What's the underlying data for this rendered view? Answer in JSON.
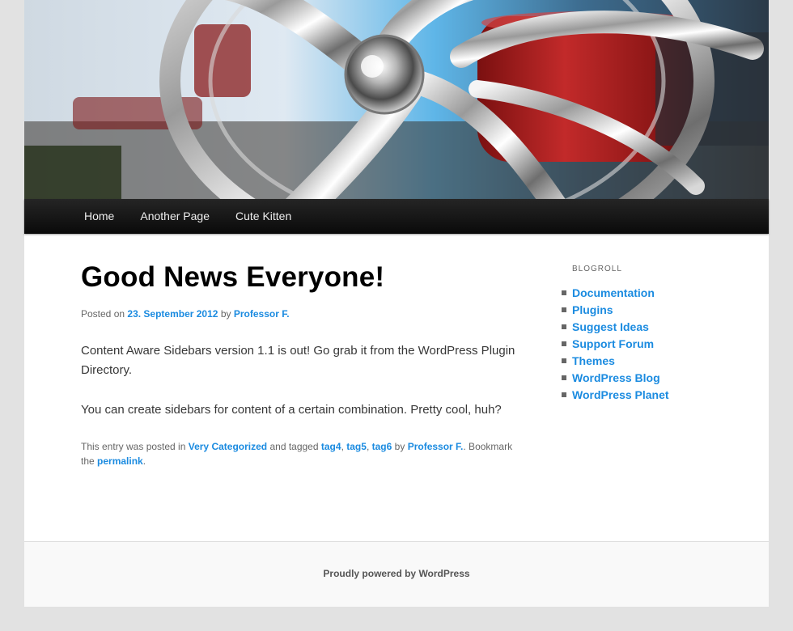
{
  "nav": {
    "items": [
      "Home",
      "Another Page",
      "Cute Kitten"
    ]
  },
  "post": {
    "title": "Good News Everyone!",
    "posted_on_label": "Posted on",
    "date": "23. September 2012",
    "by_label": "by",
    "author": "Professor F.",
    "paragraphs": [
      "Content Aware Sidebars version 1.1 is out! Go grab it from the WordPress Plugin Directory.",
      "You can create sidebars for content of a certain combination. Pretty cool, huh?"
    ],
    "footer": {
      "entry_text": "This entry was posted in",
      "category": "Very Categorized",
      "tagged_text": "and tagged",
      "tags": [
        "tag4",
        "tag5",
        "tag6"
      ],
      "comma": ",",
      "by_text": "by",
      "author": "Professor F.",
      "bookmark_text": ". Bookmark the",
      "permalink": "permalink",
      "end": "."
    }
  },
  "sidebar": {
    "title": "Blogroll",
    "links": [
      "Documentation",
      "Plugins",
      "Suggest Ideas",
      "Support Forum",
      "Themes",
      "WordPress Blog",
      "WordPress Planet"
    ]
  },
  "footer": {
    "text": "Proudly powered by WordPress"
  },
  "colors": {
    "link": "#1b8be0",
    "nav_bg": "#111111",
    "page_bg": "#e2e2e2"
  }
}
